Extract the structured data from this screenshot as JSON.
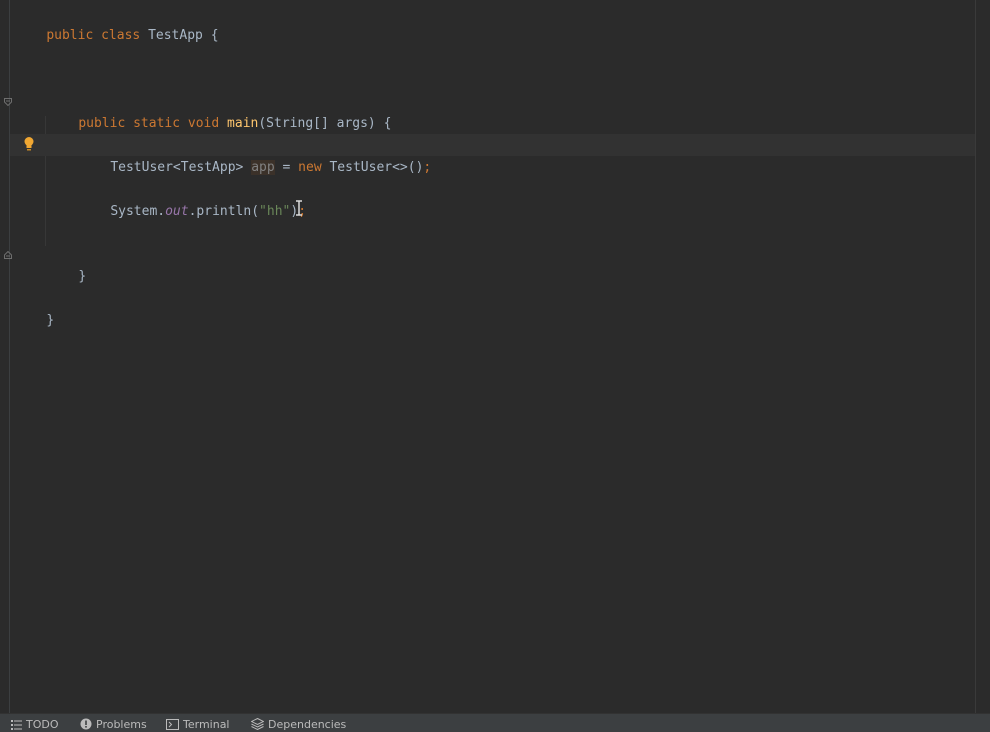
{
  "editor": {
    "lines": {
      "l1": {
        "kw1": "public",
        "kw2": "class",
        "name": "TestApp",
        "brace": "{"
      },
      "l2": {
        "kw1": "public",
        "kw2": "static",
        "kw3": "void",
        "method": "main",
        "params": "(String[] args)",
        "brace": "{"
      },
      "l3": {
        "type": "TestUser<TestApp>",
        "var": "app",
        "eq": "=",
        "kw": "new",
        "ctor": "TestUser<>()",
        "semi": ";"
      },
      "l4": {
        "obj": "System.",
        "field": "out",
        "call": ".println(",
        "str": "\"hh\"",
        "close": ")",
        "semi": ";"
      },
      "l5": {
        "brace": "}"
      },
      "l6": {
        "brace": "}"
      }
    }
  },
  "statusbar": {
    "todo": "TODO",
    "problems": "Problems",
    "terminal": "Terminal",
    "dependencies": "Dependencies"
  },
  "icons": {
    "bulb": "intention-bulb-icon",
    "fold": "fold-marker-icon"
  },
  "colors": {
    "background": "#2b2b2b",
    "keyword": "#cc7832",
    "method": "#ffc66d",
    "string": "#6a8759",
    "text": "#a9b7c6"
  }
}
